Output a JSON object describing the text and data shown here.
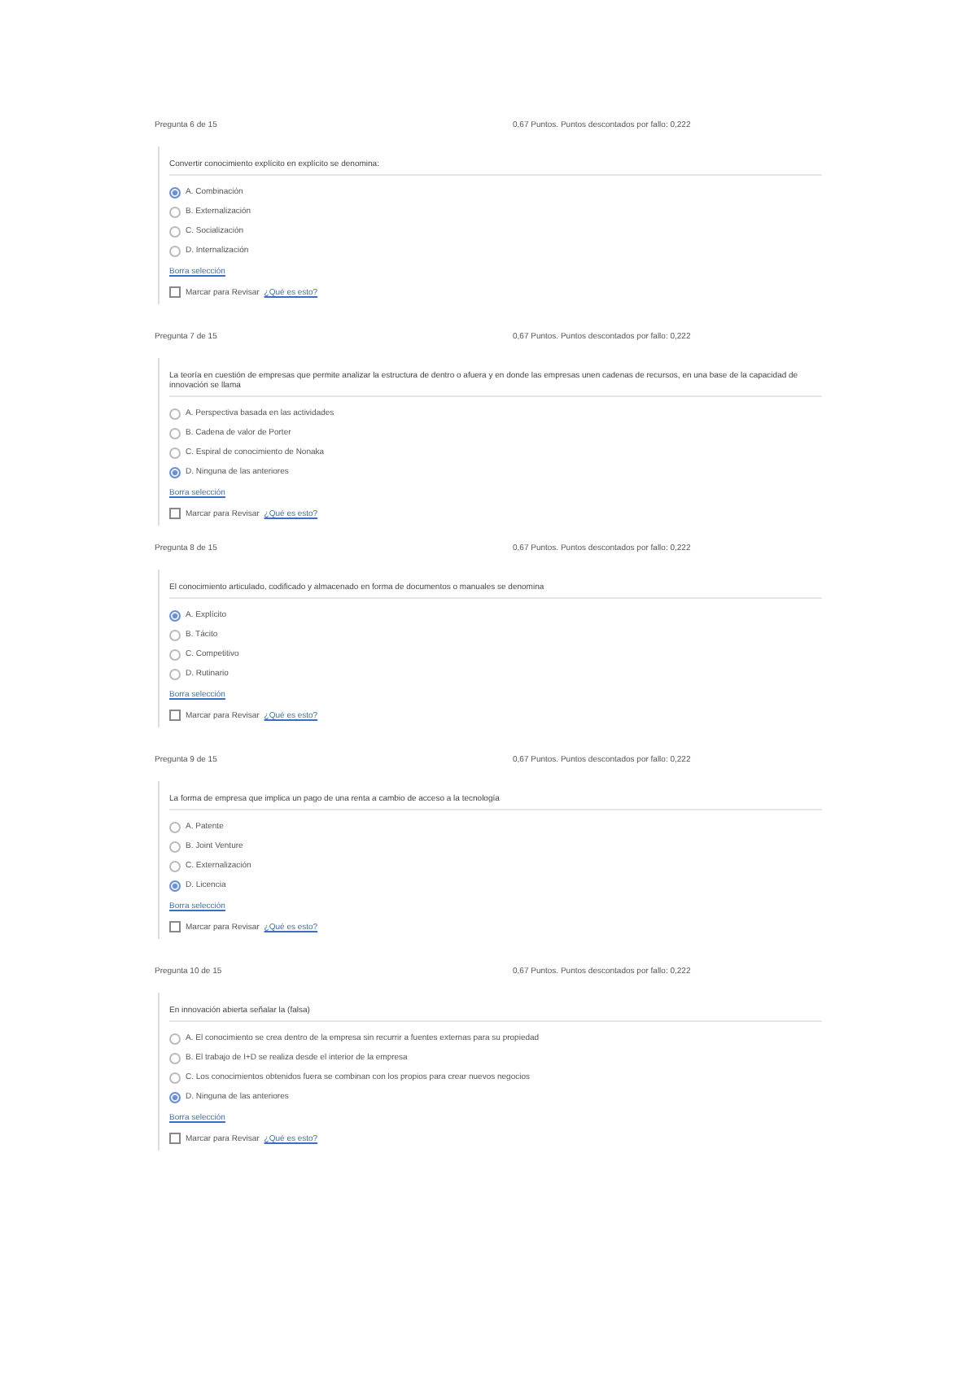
{
  "questions": [
    {
      "number": "Pregunta 6 de 15",
      "points": "0,67 Puntos. Puntos descontados por fallo: 0,222",
      "text": "Convertir conocimiento explícito en explícito se denomina:",
      "options": [
        {
          "label": "A. Combinación",
          "selected": true
        },
        {
          "label": "B. Externalización",
          "selected": false
        },
        {
          "label": "C. Socialización",
          "selected": false
        },
        {
          "label": "D. Internalización",
          "selected": false
        }
      ],
      "clear": "Borra selección",
      "review": {
        "label": "Marcar para Revisar",
        "checked": false
      },
      "help": "¿Qué es esto?"
    },
    {
      "number": "Pregunta 7 de 15",
      "points": "0,67 Puntos. Puntos descontados por fallo: 0,222",
      "text": "La teoría en cuestión de empresas que permite analizar la estructura de dentro o afuera y en donde las empresas unen cadenas de recursos, en una base de la capacidad de innovación se llama",
      "options": [
        {
          "label": "A. Perspectiva basada en las actividades",
          "selected": false
        },
        {
          "label": "B. Cadena de valor de Porter",
          "selected": false
        },
        {
          "label": "C. Espiral de conocimiento de Nonaka",
          "selected": false
        },
        {
          "label": "D. Ninguna de las anteriores",
          "selected": true
        }
      ],
      "clear": "Borra selección",
      "review": {
        "label": "Marcar para Revisar",
        "checked": false
      },
      "help": "¿Qué es esto?"
    },
    {
      "number": "Pregunta 8 de 15",
      "points": "0,67 Puntos. Puntos descontados por fallo: 0,222",
      "text": "El conocimiento articulado, codificado y almacenado en forma de documentos o manuales se denomina",
      "options": [
        {
          "label": "A. Explícito",
          "selected": true
        },
        {
          "label": "B. Tácito",
          "selected": false
        },
        {
          "label": "C. Competitivo",
          "selected": false
        },
        {
          "label": "D. Rutinario",
          "selected": false
        }
      ],
      "clear": "Borra selección",
      "review": {
        "label": "Marcar para Revisar",
        "checked": false
      },
      "help": "¿Qué es esto?"
    },
    {
      "number": "Pregunta 9 de 15",
      "points": "0,67 Puntos. Puntos descontados por fallo: 0,222",
      "text": "La forma de empresa que implica un pago de una renta a cambio de acceso a la tecnología",
      "options": [
        {
          "label": "A. Patente",
          "selected": false
        },
        {
          "label": "B. Joint Venture",
          "selected": false
        },
        {
          "label": "C. Externalización",
          "selected": false
        },
        {
          "label": "D. Licencia",
          "selected": true
        }
      ],
      "clear": "Borra selección",
      "review": {
        "label": "Marcar para Revisar",
        "checked": false
      },
      "help": "¿Qué es esto?"
    },
    {
      "number": "Pregunta 10 de 15",
      "points": "0,67 Puntos. Puntos descontados por fallo: 0,222",
      "text": "En innovación abierta señalar la (falsa)",
      "options": [
        {
          "label": "A. El conocimiento se crea dentro de la empresa sin recurrir a fuentes externas para su propiedad",
          "selected": false
        },
        {
          "label": "B. El trabajo de I+D se realiza desde el interior de la empresa",
          "selected": false
        },
        {
          "label": "C. Los conocimientos obtenidos fuera se combinan con los propios para crear nuevos negocios",
          "selected": false
        },
        {
          "label": "D. Ninguna de las anteriores",
          "selected": true
        }
      ],
      "clear": "Borra selección",
      "review": {
        "label": "Marcar para Revisar",
        "checked": false
      },
      "help": "¿Qué es esto?"
    }
  ]
}
